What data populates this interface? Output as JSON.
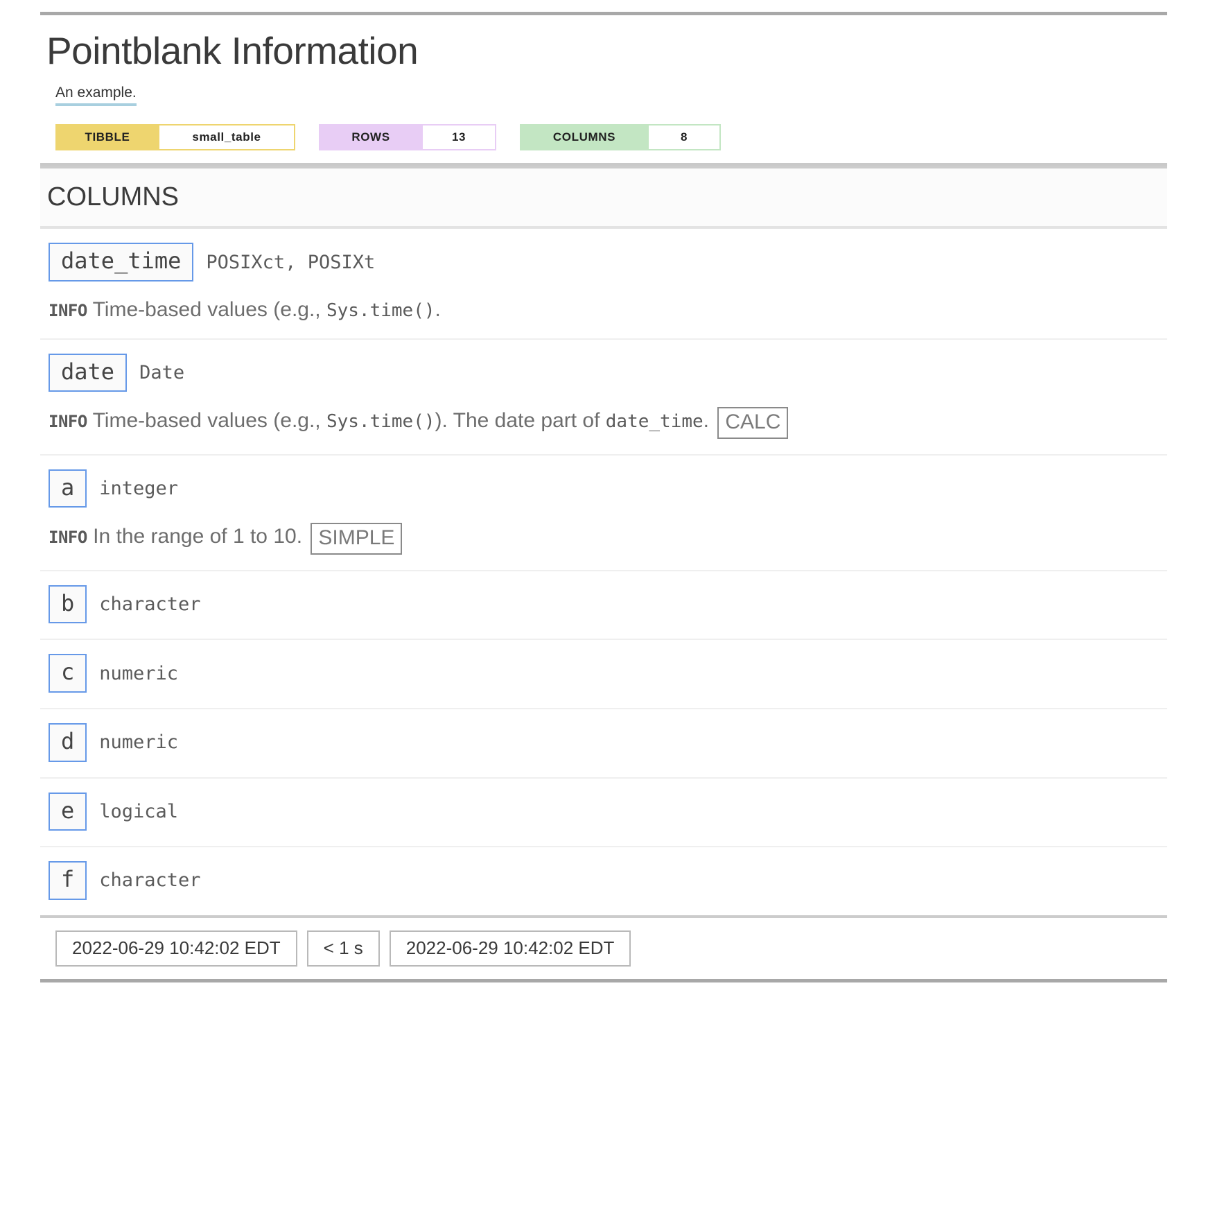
{
  "report": {
    "title": "Pointblank Information",
    "subtitle": "An example.",
    "badges": [
      {
        "id": "tibble",
        "label": "TIBBLE",
        "value": "small_table",
        "color": "#EED56F"
      },
      {
        "id": "rows",
        "label": "ROWS",
        "value": "13",
        "color": "#E8CDF5"
      },
      {
        "id": "columns",
        "label": "COLUMNS",
        "value": "8",
        "color": "#C3E6C3"
      }
    ],
    "section_title": "COLUMNS",
    "info_label": "INFO",
    "columns": [
      {
        "name": "date_time",
        "type": "POSIXct, POSIXt",
        "info_parts": [
          {
            "kind": "text",
            "text": "Time-based values (e.g., "
          },
          {
            "kind": "mono",
            "text": "Sys.time()"
          },
          {
            "kind": "text",
            "text": "."
          }
        ],
        "tag": ""
      },
      {
        "name": "date",
        "type": "Date",
        "info_parts": [
          {
            "kind": "text",
            "text": "Time-based values (e.g., "
          },
          {
            "kind": "mono",
            "text": "Sys.time()"
          },
          {
            "kind": "text",
            "text": "). The date part of "
          },
          {
            "kind": "mono",
            "text": "date_time"
          },
          {
            "kind": "text",
            "text": "."
          }
        ],
        "tag": "CALC"
      },
      {
        "name": "a",
        "type": "integer",
        "info_parts": [
          {
            "kind": "text",
            "text": "In the range of 1 to 10."
          }
        ],
        "tag": "SIMPLE"
      },
      {
        "name": "b",
        "type": "character",
        "info_parts": [],
        "tag": ""
      },
      {
        "name": "c",
        "type": "numeric",
        "info_parts": [],
        "tag": ""
      },
      {
        "name": "d",
        "type": "numeric",
        "info_parts": [],
        "tag": ""
      },
      {
        "name": "e",
        "type": "logical",
        "info_parts": [],
        "tag": ""
      },
      {
        "name": "f",
        "type": "character",
        "info_parts": [],
        "tag": ""
      }
    ],
    "footer": {
      "start_time": "2022-06-29 10:42:02 EDT",
      "duration": "< 1 s",
      "end_time": "2022-06-29 10:42:02 EDT"
    }
  }
}
